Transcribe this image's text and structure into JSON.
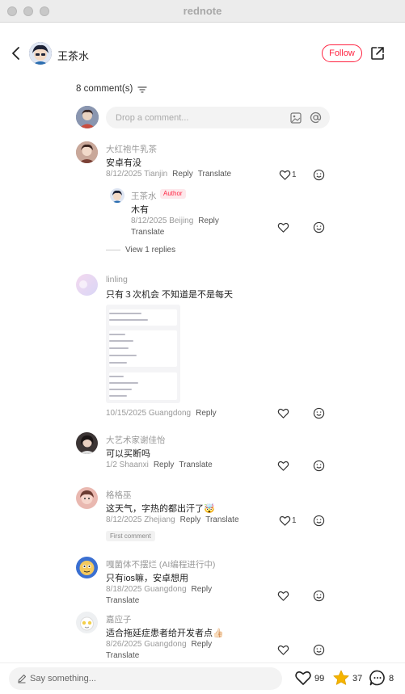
{
  "window": {
    "title": "rednote"
  },
  "header": {
    "author_name": "王茶水",
    "follow_label": "Follow"
  },
  "comments_header": {
    "count_label": "8 comment(s)"
  },
  "composer": {
    "placeholder": "Drop a comment..."
  },
  "comments": [
    {
      "user": "大红袍牛乳茶",
      "text": "安卓有没",
      "date_loc": "8/12/2025 Tianjin",
      "reply": "Reply",
      "translate": "Translate",
      "likes": "1",
      "replies": [
        {
          "user": "王茶水",
          "badge": "Author",
          "text": "木有",
          "date_loc": "8/12/2025 Beijing",
          "reply": "Reply",
          "translate": "Translate"
        }
      ],
      "view_replies": "View 1 replies"
    },
    {
      "user": "linling",
      "text": "只有３次机会 不知道是不是每天",
      "date_loc": "10/15/2025 Guangdong",
      "reply": "Reply"
    },
    {
      "user": "大艺术家谢佳怡",
      "text": "可以买断吗",
      "date_loc": "1/2 Shaanxi",
      "reply": "Reply",
      "translate": "Translate"
    },
    {
      "user": "格格巫",
      "text": "这天气，字热的都出汗了🤯",
      "date_loc": "8/12/2025 Zhejiang",
      "reply": "Reply",
      "translate": "Translate",
      "likes": "1",
      "badge": "First comment"
    },
    {
      "user": "嘎菌体不摆烂 (AI编程进行中)",
      "text": "只有ios嘛，安卓想用",
      "date_loc": "8/18/2025 Guangdong",
      "reply": "Reply",
      "translate": "Translate"
    },
    {
      "user": "嘉应子",
      "text": "适合拖延症患者给开发者点👍🏻",
      "date_loc": "8/26/2025 Guangdong",
      "reply": "Reply",
      "translate": "Translate"
    }
  ],
  "bottom_bar": {
    "placeholder": "Say something...",
    "likes": "99",
    "collects": "37",
    "comments": "8"
  },
  "colors": {
    "accent": "#ff2442",
    "collect": "#f5b400"
  },
  "icons": [
    "back-icon",
    "share-icon",
    "sort-icon",
    "image-icon",
    "at-icon",
    "heart-icon",
    "emoji-icon",
    "pen-icon",
    "star-icon",
    "comment-icon"
  ]
}
